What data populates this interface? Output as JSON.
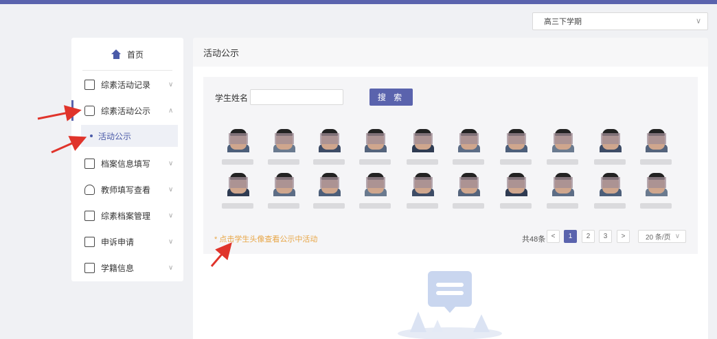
{
  "term_select": {
    "value": "高三下学期",
    "chevron": "chevron-down-icon"
  },
  "sidebar": {
    "home_label": "首页",
    "items": [
      {
        "label": "综素活动记录",
        "icon": "document-icon"
      },
      {
        "label": "综素活动公示",
        "icon": "calendar-icon"
      },
      {
        "label": "档案信息填写",
        "icon": "edit-icon"
      },
      {
        "label": "教师填写查看",
        "icon": "user-icon"
      },
      {
        "label": "综素档案管理",
        "icon": "folder-icon"
      },
      {
        "label": "申诉申请",
        "icon": "appeal-icon"
      },
      {
        "label": "学籍信息",
        "icon": "book-icon"
      }
    ],
    "submenu": {
      "label": "活动公示"
    }
  },
  "main": {
    "title": "活动公示",
    "search": {
      "label": "学生姓名",
      "value": "",
      "button": "搜 索"
    },
    "hint": "* 点击学生头像查看公示中活动",
    "pagination": {
      "total": "共48条",
      "pages": [
        "1",
        "2",
        "3"
      ],
      "current": "1",
      "page_size": "20 条/页"
    }
  },
  "colors": {
    "accent": "#5a63ad",
    "hint": "#e8a646",
    "arrow": "#e0342b"
  }
}
